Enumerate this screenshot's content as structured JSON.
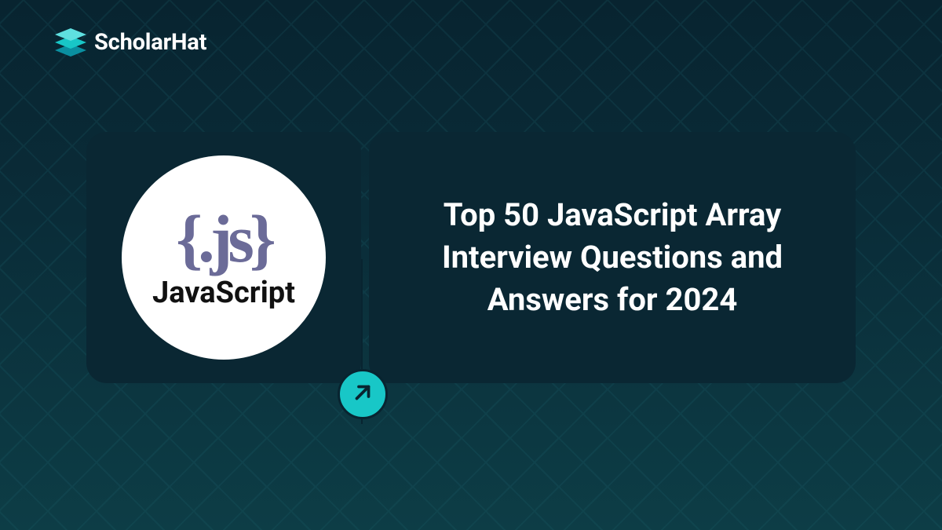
{
  "brand": {
    "name": "ScholarHat",
    "accent_color": "#18c7c7",
    "dark_accent": "#0a8fa0"
  },
  "card": {
    "js_symbol": "{.js}",
    "js_label": "JavaScript",
    "title": "Top 50 JavaScript Array Interview Questions and Answers for 2024"
  },
  "icons": {
    "arrow": "arrow-up-right"
  }
}
